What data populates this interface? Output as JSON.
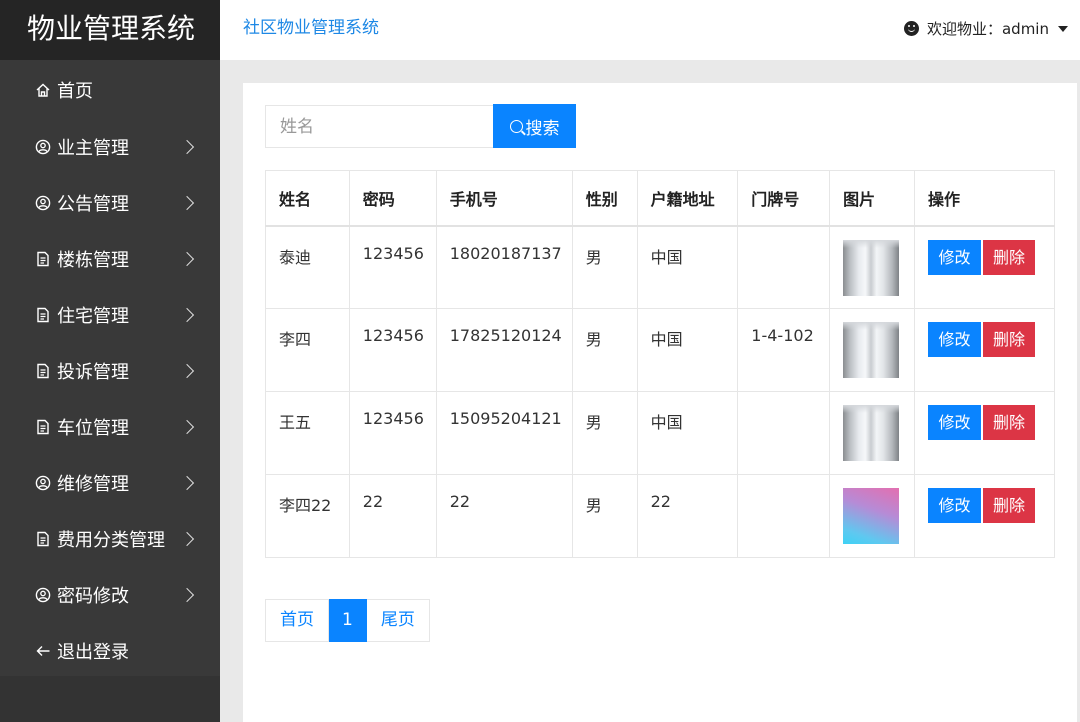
{
  "sidebar": {
    "brand": "物业管理系统",
    "items": [
      {
        "label": "首页",
        "icon": "home-icon",
        "chevron": false
      },
      {
        "label": "业主管理",
        "icon": "user-circle-icon",
        "chevron": true
      },
      {
        "label": "公告管理",
        "icon": "user-circle-icon",
        "chevron": true
      },
      {
        "label": "楼栋管理",
        "icon": "document-icon",
        "chevron": true
      },
      {
        "label": "住宅管理",
        "icon": "document-icon",
        "chevron": true
      },
      {
        "label": "投诉管理",
        "icon": "document-icon",
        "chevron": true
      },
      {
        "label": "车位管理",
        "icon": "document-icon",
        "chevron": true
      },
      {
        "label": "维修管理",
        "icon": "user-circle-icon",
        "chevron": true
      },
      {
        "label": "费用分类管理",
        "icon": "document-icon",
        "chevron": true
      },
      {
        "label": "密码修改",
        "icon": "user-circle-icon",
        "chevron": true
      },
      {
        "label": "退出登录",
        "icon": "arrow-left-icon",
        "chevron": false
      }
    ]
  },
  "header": {
    "title": "社区物业管理系统",
    "user_label": "欢迎物业：admin"
  },
  "search": {
    "placeholder": "姓名",
    "value": "",
    "button_label": "搜索"
  },
  "table": {
    "columns": [
      "姓名",
      "密码",
      "手机号",
      "性别",
      "户籍地址",
      "门牌号",
      "图片",
      "操作"
    ],
    "rows": [
      {
        "name": "泰迪",
        "password": "123456",
        "phone": "18020187137",
        "gender": "男",
        "address": "中国",
        "door": "",
        "image": "aisle-photo"
      },
      {
        "name": "李四",
        "password": "123456",
        "phone": "17825120124",
        "gender": "男",
        "address": "中国",
        "door": "1-4-102",
        "image": "aisle-photo"
      },
      {
        "name": "王五",
        "password": "123456",
        "phone": "15095204121",
        "gender": "男",
        "address": "中国",
        "door": "",
        "image": "aisle-photo"
      },
      {
        "name": "李四22",
        "password": "22",
        "phone": "22",
        "gender": "男",
        "address": "22",
        "door": "",
        "image": "gradient-image"
      }
    ],
    "edit_label": "修改",
    "delete_label": "删除"
  },
  "pagination": {
    "first_label": "首页",
    "current": "1",
    "last_label": "尾页"
  },
  "colors": {
    "primary": "#0a84ff",
    "danger": "#dc3545",
    "sidebar_bg": "#393939",
    "brand_bg": "#252525"
  }
}
